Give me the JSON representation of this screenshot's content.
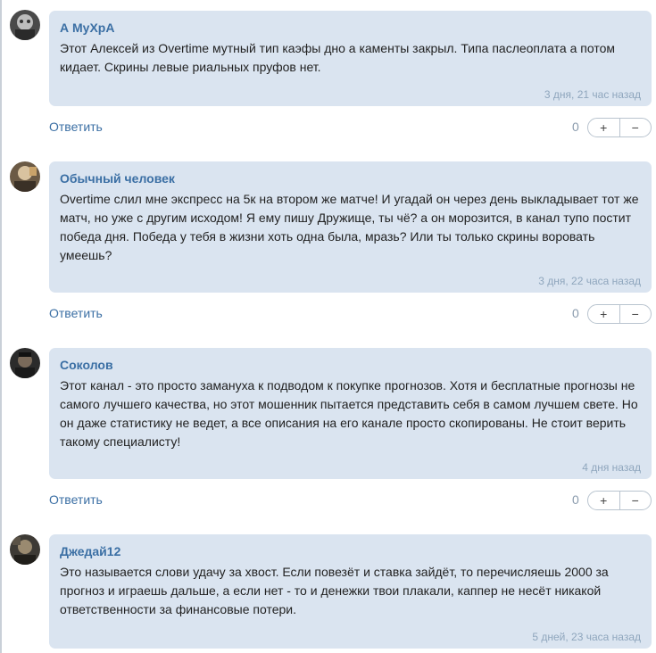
{
  "comments": [
    {
      "author": "А МуХрА",
      "text": "Этот Алексей из Overtime мутный тип каэфы дно а каменты закрыл. Типа паслеоплата а потом кидает. Скрины левые риальных пруфов нет.",
      "time": "3 дня, 21 час назад",
      "reply_label": "Ответить",
      "votes": "0",
      "plus": "+",
      "minus": "−"
    },
    {
      "author": "Обычный человек",
      "text": "Overtime слил мне экспресс на 5к на втором же матче! И угадай он через день выкладывает тот же матч, но уже с другим исходом! Я ему пишу Дружище, ты чё? а он морозится, в канал тупо постит победа дня. Победа у тебя в жизни хоть одна была, мразь? Или ты только скрины воровать умеешь?",
      "time": "3 дня, 22 часа назад",
      "reply_label": "Ответить",
      "votes": "0",
      "plus": "+",
      "minus": "−"
    },
    {
      "author": "Соколов",
      "text": "Этот канал - это просто замануха к подводом к покупке прогнозов. Хотя и бесплатные прогнозы не самого лучшего качества, но этот мошенник пытается представить себя в самом лучшем свете. Но он даже статистику не ведет, а все описания на его канале просто скопированы. Не стоит верить такому специалисту!",
      "time": "4 дня назад",
      "reply_label": "Ответить",
      "votes": "0",
      "plus": "+",
      "minus": "−"
    },
    {
      "author": "Джедай12",
      "text": "Это называется слови удачу за хвост. Если повезёт и ставка зайдёт, то перечисляешь 2000 за прогноз и играешь дальше, а если нет - то и денежки твои плакали, каппер не несёт никакой ответственности за финансовые потери.",
      "time": "5 дней, 23 часа назад"
    }
  ]
}
